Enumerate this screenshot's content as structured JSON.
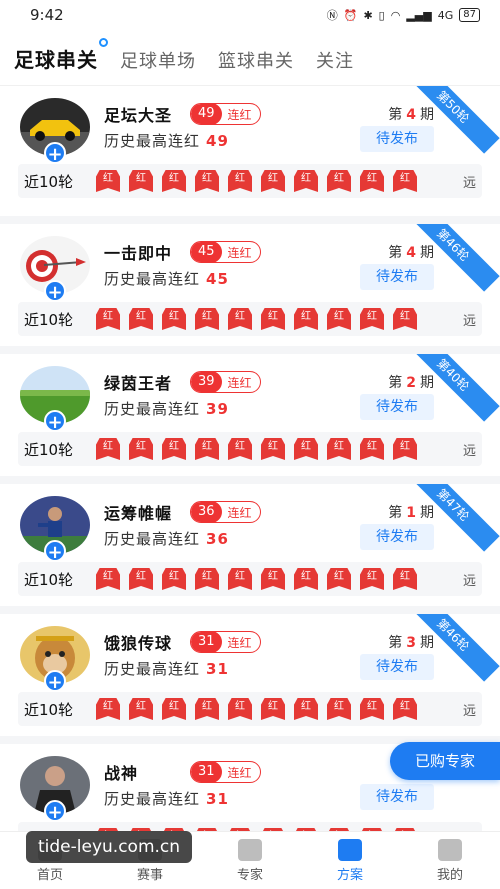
{
  "status_bar": {
    "time": "9:42",
    "network": "4G",
    "battery": "87"
  },
  "tabs": [
    {
      "label": "足球串关",
      "active": true
    },
    {
      "label": "足球单场",
      "active": false
    },
    {
      "label": "篮球串关",
      "active": false
    },
    {
      "label": "关注",
      "active": false
    }
  ],
  "common": {
    "streak_suffix": "连红",
    "history_label": "历史最高连红",
    "period_prefix": "第",
    "period_suffix": "期",
    "publish_label": "待发布",
    "recent_label": "近10轮",
    "pill_label": "红",
    "far_label": "远"
  },
  "experts": [
    {
      "name": "足坛大圣",
      "streak": "49",
      "history": "49",
      "period": "4",
      "ribbon": "第50轮",
      "avatar": "car"
    },
    {
      "name": "一击即中",
      "streak": "45",
      "history": "45",
      "period": "4",
      "ribbon": "第46轮",
      "avatar": "dart"
    },
    {
      "name": "绿茵王者",
      "streak": "39",
      "history": "39",
      "period": "2",
      "ribbon": "第40轮",
      "avatar": "grass"
    },
    {
      "name": "运筹帷幄",
      "streak": "36",
      "history": "36",
      "period": "1",
      "ribbon": "第47轮",
      "avatar": "player"
    },
    {
      "name": "饿狼传球",
      "streak": "31",
      "history": "31",
      "period": "3",
      "ribbon": "第46轮",
      "avatar": "monkey"
    },
    {
      "name": "战神",
      "streak": "31",
      "history": "31",
      "period": "",
      "ribbon": "",
      "avatar": "man"
    }
  ],
  "float_button": "已购专家",
  "bottom_nav": [
    {
      "label": "首页",
      "icon": "home-icon",
      "active": false
    },
    {
      "label": "赛事",
      "icon": "trophy-icon",
      "active": false
    },
    {
      "label": "专家",
      "icon": "expert-icon",
      "active": false
    },
    {
      "label": "方案",
      "icon": "plan-icon",
      "active": true
    },
    {
      "label": "我的",
      "icon": "profile-icon",
      "active": false
    }
  ],
  "watermark": "tide-leyu.com.cn",
  "colors": {
    "accent": "#1e7cf2",
    "red": "#e53935"
  }
}
